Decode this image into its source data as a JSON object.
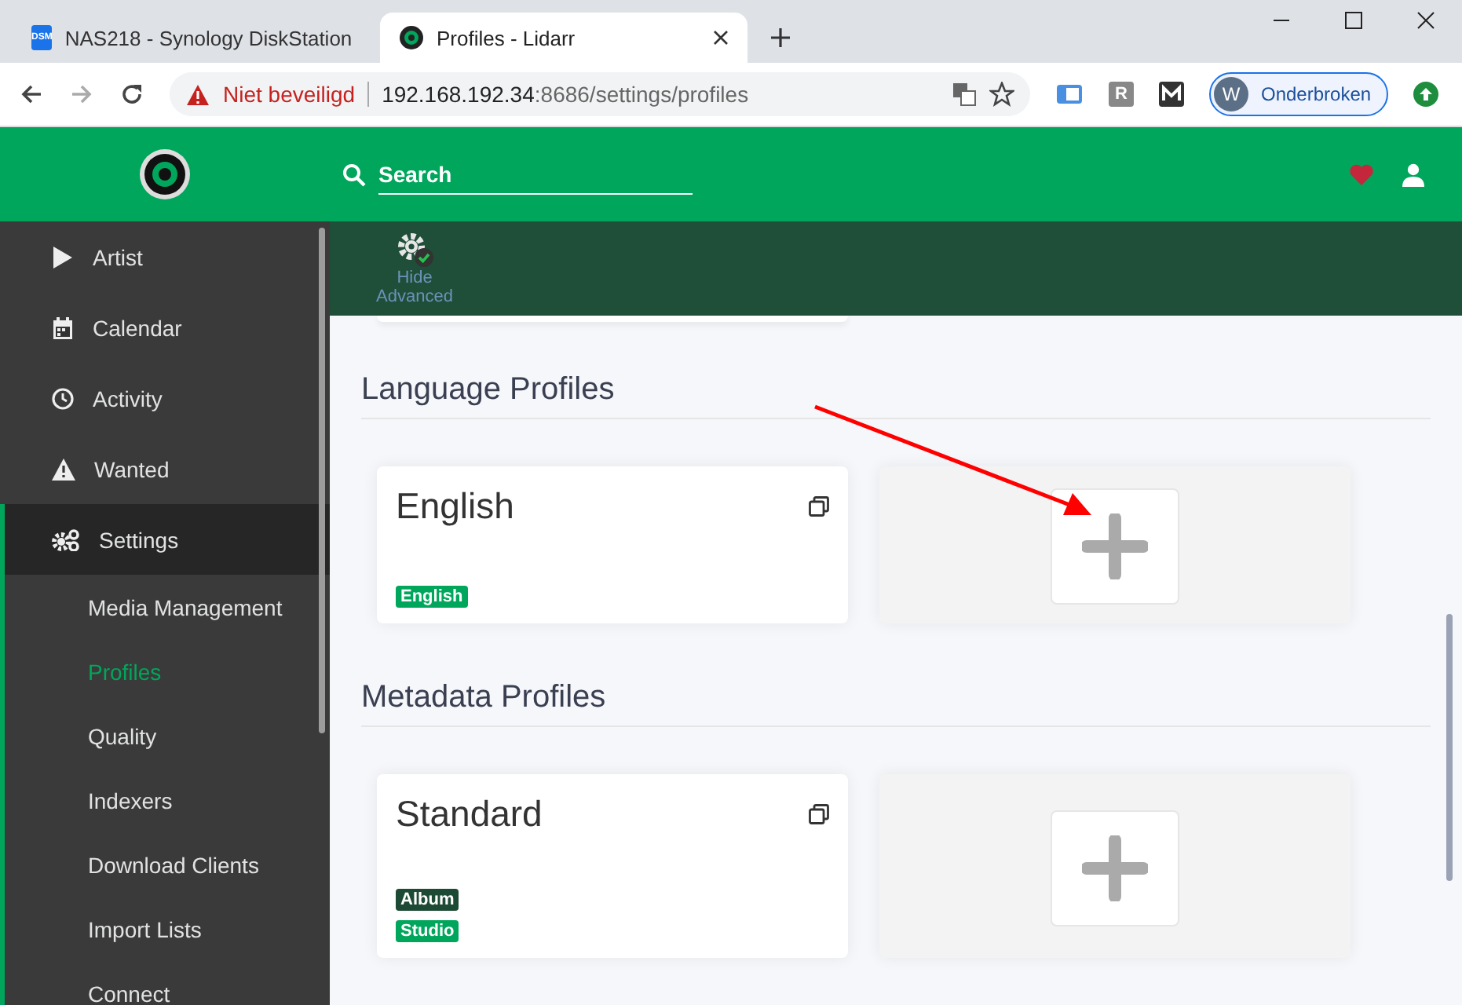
{
  "browser": {
    "tabs": [
      {
        "title": "NAS218 - Synology DiskStation",
        "icon_text": "DSM",
        "kind": "dsm",
        "selected": false
      },
      {
        "title": "Profiles - Lidarr",
        "kind": "lidarr",
        "selected": true
      }
    ],
    "address": {
      "security": "Niet beveiligd",
      "host": "192.168.192.34",
      "path": ":8686/settings/profiles"
    },
    "extension_letter": "R",
    "profile": {
      "initial": "W",
      "name": "Onderbroken"
    }
  },
  "header": {
    "search": {
      "placeholder": "Search"
    }
  },
  "toolbar": {
    "button": "Hide Advanced"
  },
  "sidebar": {
    "items": [
      {
        "label": "Artist",
        "kind": "play",
        "selected": false
      },
      {
        "label": "Calendar",
        "kind": "calendar",
        "selected": false
      },
      {
        "label": "Activity",
        "kind": "clock",
        "selected": false
      },
      {
        "label": "Wanted",
        "kind": "warning",
        "selected": false
      },
      {
        "label": "Settings",
        "kind": "gears",
        "selected": true,
        "children": [
          {
            "label": "Media Management",
            "selected": false
          },
          {
            "label": "Profiles",
            "selected": true
          },
          {
            "label": "Quality",
            "selected": false
          },
          {
            "label": "Indexers",
            "selected": false
          },
          {
            "label": "Download Clients",
            "selected": false
          },
          {
            "label": "Import Lists",
            "selected": false
          },
          {
            "label": "Connect",
            "selected": false
          }
        ]
      }
    ]
  },
  "sections": [
    {
      "title": "Language Profiles",
      "cards": [
        {
          "name": "English",
          "tags": [
            {
              "label": "English",
              "color": "#00a65b"
            }
          ]
        }
      ]
    },
    {
      "title": "Metadata Profiles",
      "cards": [
        {
          "name": "Standard",
          "tags": [
            {
              "label": "Album",
              "color": "#1d4a34"
            },
            {
              "label": "Studio",
              "color": "#00a65b"
            }
          ]
        }
      ]
    }
  ]
}
